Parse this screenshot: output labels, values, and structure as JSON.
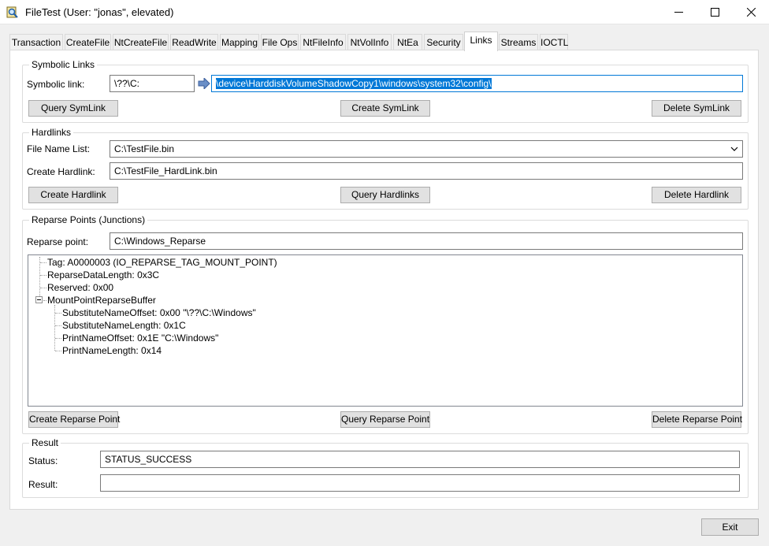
{
  "window": {
    "title": "FileTest (User: \"jonas\", elevated)",
    "minimize_glyph": "—",
    "maximize_glyph": "☐",
    "close_glyph": "✕"
  },
  "tabs": [
    {
      "label": "Transaction"
    },
    {
      "label": "CreateFile"
    },
    {
      "label": "NtCreateFile"
    },
    {
      "label": "ReadWrite"
    },
    {
      "label": "Mapping"
    },
    {
      "label": "File Ops"
    },
    {
      "label": "NtFileInfo"
    },
    {
      "label": "NtVolInfo"
    },
    {
      "label": "NtEa"
    },
    {
      "label": "Security"
    },
    {
      "label": "Links"
    },
    {
      "label": "Streams"
    },
    {
      "label": "IOCTL"
    }
  ],
  "active_tab": "Links",
  "symbolic_links": {
    "group_title": "Symbolic Links",
    "link_label": "Symbolic link:",
    "link_value": "\\??\\C:",
    "target_value": "\\device\\HarddiskVolumeShadowCopy1\\windows\\system32\\config\\",
    "query_button": "Query SymLink",
    "create_button": "Create SymLink",
    "delete_button": "Delete SymLink"
  },
  "hardlinks": {
    "group_title": "Hardlinks",
    "file_list_label": "File Name List:",
    "file_list_value": "C:\\TestFile.bin",
    "create_label": "Create Hardlink:",
    "create_value": "C:\\TestFile_HardLink.bin",
    "create_button": "Create Hardlink",
    "query_button": "Query Hardlinks",
    "delete_button": "Delete Hardlink"
  },
  "reparse": {
    "group_title": "Reparse Points (Junctions)",
    "point_label": "Reparse point:",
    "point_value": "C:\\Windows_Reparse",
    "tree": [
      {
        "text": "Tag: A0000003 (IO_REPARSE_TAG_MOUNT_POINT)"
      },
      {
        "text": "ReparseDataLength: 0x3C"
      },
      {
        "text": "Reserved: 0x00"
      },
      {
        "text": "MountPointReparseBuffer"
      },
      {
        "text": "SubstituteNameOffset: 0x00 \"\\??\\C:\\Windows\""
      },
      {
        "text": "SubstituteNameLength: 0x1C"
      },
      {
        "text": "PrintNameOffset: 0x1E \"C:\\Windows\""
      },
      {
        "text": "PrintNameLength: 0x14"
      }
    ],
    "create_button": "Create Reparse Point",
    "query_button": "Query Reparse Point",
    "delete_button": "Delete Reparse Point"
  },
  "result": {
    "group_title": "Result",
    "status_label": "Status:",
    "status_value": "STATUS_SUCCESS",
    "result_label": "Result:",
    "result_value": ""
  },
  "footer": {
    "exit_button": "Exit"
  }
}
